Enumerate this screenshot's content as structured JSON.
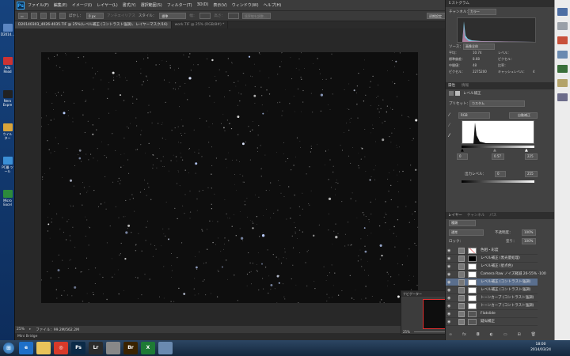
{
  "desktop": {
    "icons": [
      {
        "label": "D2014...",
        "color": "#5b86c2"
      },
      {
        "label": "Ado Read",
        "color": "#c33"
      },
      {
        "label": "Nero Expre",
        "color": "#222"
      },
      {
        "label": "ウイル ター",
        "color": "#d9a43a"
      },
      {
        "label": "PC最 ツール",
        "color": "#3b8fd6"
      },
      {
        "label": "Micro Excel",
        "color": "#2c8a3c"
      }
    ]
  },
  "menubar": {
    "logo": "Ps",
    "items": [
      "ファイル(F)",
      "編集(E)",
      "イメージ(I)",
      "レイヤー(L)",
      "書式(Y)",
      "選択範囲(S)",
      "フィルター(T)",
      "3D(D)",
      "表示(V)",
      "ウィンドウ(W)",
      "ヘルプ(H)"
    ],
    "window_buttons": [
      "–",
      "▫",
      "✕"
    ]
  },
  "options": {
    "feather_label": "ぼかし：",
    "feather_value": "0 px",
    "antialias": "アンチエイリアス",
    "style_label": "スタイル：",
    "style_value": "標準",
    "width_label": "幅：",
    "height_label": "高さ：",
    "refine_button": "境界線を調整...",
    "workspace": "初期設定"
  },
  "tabs": [
    {
      "label": "D20140303_4026-4035.TIF @ 25%(レベル補正 (コントラスト強調)、レイヤーマスク/16)",
      "active": true
    },
    {
      "label": "work.TIF @ 25% (RGB/8#) *",
      "active": false
    }
  ],
  "status": {
    "zoom": "25%",
    "file_info": "ファイル：99.2M/562.2M",
    "minibridge": "Mini Bridge"
  },
  "histogram": {
    "title": "ヒストグラム",
    "channel_label": "チャンネル：",
    "channel_value": "カラー",
    "source_label": "ソース：",
    "source_value": "画像全体",
    "stats": [
      {
        "k": "平均：",
        "v": "10.74",
        "k2": "レベル：",
        "v2": ""
      },
      {
        "k": "標準偏差：",
        "v": "8.68",
        "k2": "ピクセル：",
        "v2": ""
      },
      {
        "k": "中間値：",
        "v": "48",
        "k2": "比率：",
        "v2": ""
      },
      {
        "k": "ピクセル：",
        "v": "2275200",
        "k2": "キャッシュレベル：",
        "v2": "4"
      }
    ]
  },
  "properties": {
    "tabs": [
      "属性",
      "情報"
    ],
    "title": "レベル補正",
    "preset_label": "プリセット：",
    "preset_value": "カスタム",
    "channel_value": "RGB",
    "auto_button": "自動補正",
    "input_values": [
      "0",
      "0.57",
      "225"
    ],
    "output_label": "出力レベル：",
    "output_values": [
      "0",
      "255"
    ]
  },
  "layers": {
    "tabs": [
      "レイヤー",
      "チャンネル",
      "パス"
    ],
    "kind_label": "種類",
    "blend_value": "通常",
    "opacity_label": "不透明度：",
    "opacity_value": "100%",
    "lock_label": "ロック：",
    "fill_label": "塗り：",
    "fill_value": "100%",
    "items": [
      {
        "name": "色相・彩度",
        "active": false
      },
      {
        "name": "レベル補正 (黒光量処理)",
        "active": false
      },
      {
        "name": "レベル補正 (星点色)",
        "active": false
      },
      {
        "name": "Camera Raw ノイズ軽減 26-55% -100",
        "active": false
      },
      {
        "name": "レベル補正 (コントラスト強調)",
        "active": true
      },
      {
        "name": "レベル補正 (コントラスト強調)",
        "active": false
      },
      {
        "name": "トーンカーブ (コントラスト強調)",
        "active": false
      },
      {
        "name": "トーンカーブ (コントラスト強調)",
        "active": false
      },
      {
        "name": "Flatslide",
        "active": false
      },
      {
        "name": "疑似補正",
        "active": false
      }
    ]
  },
  "navigator": {
    "title": "ナビゲーター",
    "zoom": "25%"
  },
  "taskbar": {
    "apps": [
      {
        "label": "e",
        "color": "#1e6fc8"
      },
      {
        "label": "",
        "color": "#e8c35a"
      },
      {
        "label": "◎",
        "color": "#d83a2a"
      },
      {
        "label": "Ps",
        "color": "#0b2a47"
      },
      {
        "label": "Lr",
        "color": "#2b2b2b"
      },
      {
        "label": "",
        "color": "#888"
      },
      {
        "label": "Br",
        "color": "#3a2300"
      },
      {
        "label": "X",
        "color": "#1e7a35"
      },
      {
        "label": "",
        "color": "#6a8ab0"
      }
    ],
    "time": "18:00",
    "date": "2014/03/24"
  }
}
